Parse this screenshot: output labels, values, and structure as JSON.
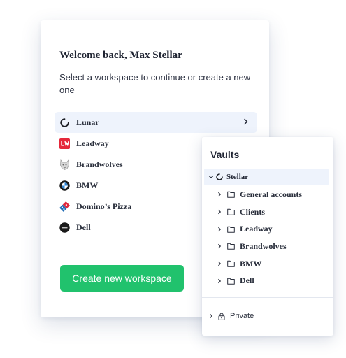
{
  "welcome": {
    "title": "Welcome back, Max Stellar"
  },
  "subtitle": "Select a workspace to continue or create a new one",
  "workspaces": [
    {
      "label": "Lunar",
      "icon": "lunar-logo-icon",
      "active": true
    },
    {
      "label": "Leadway",
      "icon": "leadway-logo-icon"
    },
    {
      "label": "Brandwolves",
      "icon": "brandwolves-logo-icon"
    },
    {
      "label": "BMW",
      "icon": "bmw-logo-icon"
    },
    {
      "label": "Domino’s Pizza",
      "icon": "dominos-logo-icon"
    },
    {
      "label": "Dell",
      "icon": "dell-logo-icon"
    }
  ],
  "create_button": {
    "label": "Create new workspace"
  },
  "vaults": {
    "title": "Vaults",
    "root": {
      "label": "Stellar",
      "expanded": true
    },
    "folders": [
      {
        "label": "General accounts"
      },
      {
        "label": "Clients"
      },
      {
        "label": "Leadway"
      },
      {
        "label": "Brandwolves"
      },
      {
        "label": "BMW"
      },
      {
        "label": "Dell"
      }
    ],
    "private": {
      "label": "Private"
    }
  },
  "colors": {
    "accent_green": "#21c26d",
    "active_bg": "#eef3fc",
    "leadway_red": "#e5283a",
    "dominos_blue": "#1f6bb5",
    "dominos_red": "#e0263a"
  }
}
